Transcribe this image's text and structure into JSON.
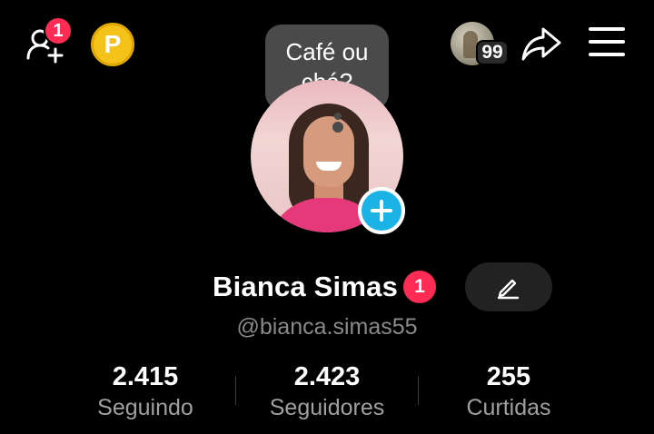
{
  "header": {
    "friend_requests_badge": "1",
    "coin_letter": "P",
    "story_count": "99"
  },
  "profile": {
    "bubble_text_line1": "Café ou",
    "bubble_text_line2": "chá?",
    "name": "Bianca Simas",
    "name_badge": "1",
    "handle": "@bianca.simas55"
  },
  "stats": [
    {
      "value": "2.415",
      "label": "Seguindo"
    },
    {
      "value": "2.423",
      "label": "Seguidores"
    },
    {
      "value": "255",
      "label": "Curtidas"
    }
  ],
  "colors": {
    "background": "#000000",
    "badge": "#fe2c55",
    "coin": "#f5c21a",
    "add_button": "#1bb2e6",
    "edit_button_bg": "#222222"
  },
  "icons": [
    "add-friend-icon",
    "coin-icon",
    "share-icon",
    "menu-icon",
    "plus-icon",
    "pencil-icon"
  ]
}
